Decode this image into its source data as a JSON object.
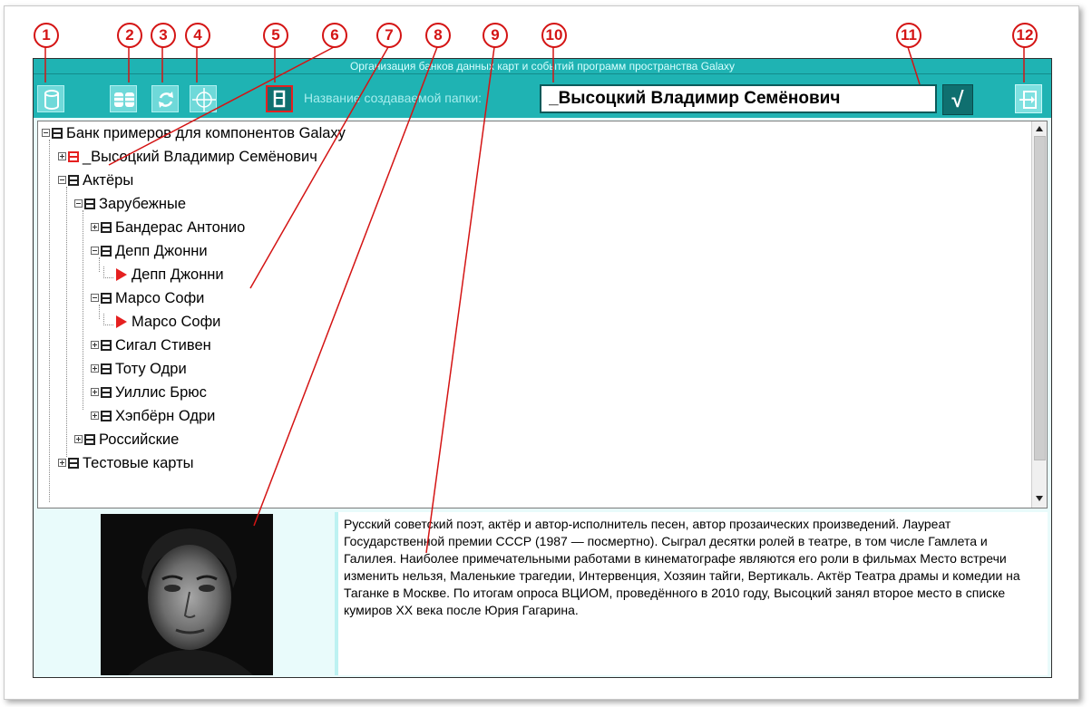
{
  "markers": [
    "1",
    "2",
    "3",
    "4",
    "5",
    "6",
    "7",
    "8",
    "9",
    "10",
    "11",
    "12"
  ],
  "window": {
    "title": "Организация банков данных карт и событий программ пространства Galaxy"
  },
  "toolbar": {
    "folder_label": "Название создаваемой папки:",
    "folder_value": "_Высоцкий Владимир Семёнович",
    "ok_glyph": "√",
    "icons": [
      "database-icon",
      "databases-icon",
      "refresh-icon",
      "crosshair-icon",
      "new-folder-icon",
      "confirm-icon",
      "exit-icon"
    ]
  },
  "tree": {
    "root": "Банк примеров для компонентов Galaxy",
    "items": [
      "_Высоцкий Владимир Семёнович",
      "Актёры",
      "Зарубежные",
      "Бандерас Антонио",
      "Депп Джонни",
      "Депп Джонни",
      "Марсо Софи",
      "Марсо Софи",
      "Сигал Стивен",
      "Тоту Одри",
      "Уиллис Брюс",
      "Хэпбёрн Одри",
      "Российские",
      "Тестовые карты"
    ]
  },
  "description": "Русский советский поэт, актёр и автор-исполнитель песен, автор прозаических произведений. Лауреат Государственной премии СССР (1987 — посмертно). Сыграл десятки ролей в театре, в том числе Гамлета и Галилея. Наиболее примечательными работами в кинематографе являются его роли в фильмах Место встречи изменить нельзя, Маленькие трагедии, Интервенция, Хозяин тайги, Вертикаль. Актёр Театра драмы и комедии на Таганке в Москве.  По итогам опроса ВЦИОМ, проведённого в 2010 году, Высоцкий занял второе место в списке кумиров XX века после Юрия Гагарина.",
  "colors": {
    "accent": "#1fb3b3",
    "marker": "#d41414",
    "panel": "#e9fbfb"
  }
}
